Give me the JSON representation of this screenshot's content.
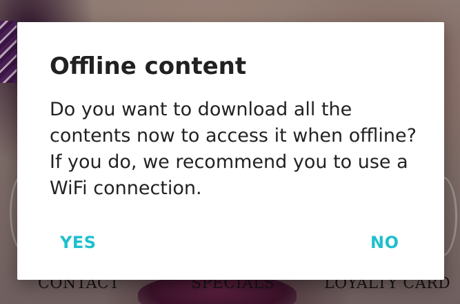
{
  "background": {
    "nav_items": [
      {
        "label": "CONTACT"
      },
      {
        "label": "SPECIALS"
      },
      {
        "label": "LOYALTY CARD"
      }
    ]
  },
  "dialog": {
    "title": "Offline content",
    "message": "Do you want to download all the contents now to access it when offline? If you do, we recommend you to use a WiFi connection.",
    "positive_label": "YES",
    "negative_label": "NO",
    "accent_color": "#1fbfcc"
  }
}
